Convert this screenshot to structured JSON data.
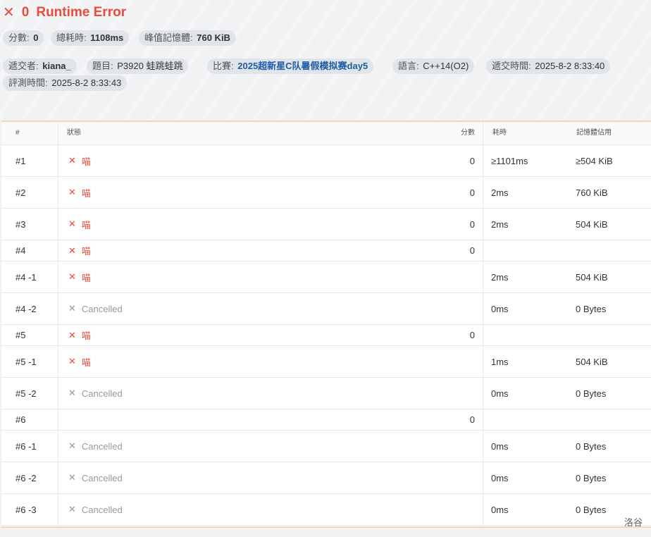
{
  "header": {
    "status_icon": "close-icon",
    "score": "0",
    "status": "Runtime Error",
    "colors": {
      "error": "#e74c3c",
      "link": "#1c5da8",
      "pill_bg": "#e1e4e8"
    }
  },
  "stats": {
    "score_label": "分數:",
    "score_value": "0",
    "time_label": "總耗時:",
    "time_value": "1108ms",
    "mem_label": "峰值記憶體:",
    "mem_value": "760 KiB"
  },
  "meta": {
    "submitter_label": "遞交者:",
    "submitter": "kiana_",
    "problem_label": "題目:",
    "problem": "P3920  蛙跳蛙跳",
    "contest_label": "比賽:",
    "contest": "2025超新星C队暑假模拟赛day5",
    "lang_label": "語言:",
    "lang": "C++14(O2)",
    "submit_time_label": "遞交時間:",
    "submit_time": "2025-8-2 8:33:40",
    "judge_time_label": "評測時間:",
    "judge_time": "2025-8-2 8:33:43"
  },
  "table": {
    "headers": {
      "id": "#",
      "status": "狀態",
      "score": "分數",
      "time": "耗時",
      "memory": "記憶體佔用"
    },
    "rows": [
      {
        "id": "#1",
        "status": "喵",
        "kind": "fail",
        "score": "0",
        "time": "≥1101ms",
        "memory": "≥504 KiB"
      },
      {
        "id": "#2",
        "status": "喵",
        "kind": "fail",
        "score": "0",
        "time": "2ms",
        "memory": "760 KiB"
      },
      {
        "id": "#3",
        "status": "喵",
        "kind": "fail",
        "score": "0",
        "time": "2ms",
        "memory": "504 KiB"
      },
      {
        "id": "#4",
        "status": "喵",
        "kind": "fail",
        "score": "0",
        "time": "",
        "memory": "",
        "compact": true
      },
      {
        "id": "#4 -1",
        "status": "喵",
        "kind": "fail",
        "score": "",
        "time": "2ms",
        "memory": "504 KiB"
      },
      {
        "id": "#4 -2",
        "status": "Cancelled",
        "kind": "cancel",
        "score": "",
        "time": "0ms",
        "memory": "0 Bytes"
      },
      {
        "id": "#5",
        "status": "喵",
        "kind": "fail",
        "score": "0",
        "time": "",
        "memory": "",
        "compact": true
      },
      {
        "id": "#5 -1",
        "status": "喵",
        "kind": "fail",
        "score": "",
        "time": "1ms",
        "memory": "504 KiB"
      },
      {
        "id": "#5 -2",
        "status": "Cancelled",
        "kind": "cancel",
        "score": "",
        "time": "0ms",
        "memory": "0 Bytes"
      },
      {
        "id": "#6",
        "status": "",
        "kind": "none",
        "score": "0",
        "time": "",
        "memory": "",
        "compact": true
      },
      {
        "id": "#6 -1",
        "status": "Cancelled",
        "kind": "cancel",
        "score": "",
        "time": "0ms",
        "memory": "0 Bytes"
      },
      {
        "id": "#6 -2",
        "status": "Cancelled",
        "kind": "cancel",
        "score": "",
        "time": "0ms",
        "memory": "0 Bytes"
      },
      {
        "id": "#6 -3",
        "status": "Cancelled",
        "kind": "cancel",
        "score": "",
        "time": "0ms",
        "memory": "0 Bytes"
      }
    ]
  },
  "footer": {
    "brand": "洛谷"
  }
}
